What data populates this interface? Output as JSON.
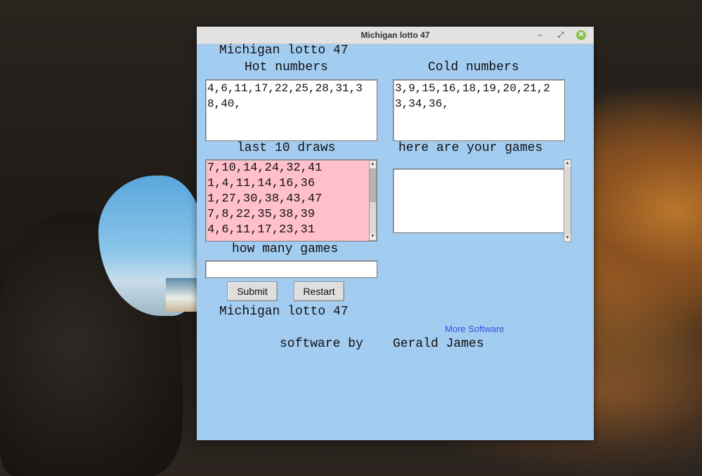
{
  "window": {
    "title": "Michigan lotto 47"
  },
  "header": {
    "title": "Michigan lotto 47"
  },
  "hot": {
    "label": "Hot numbers",
    "value": "4,6,11,17,22,25,28,31,38,40,"
  },
  "cold": {
    "label": "Cold numbers",
    "value": "3,9,15,16,18,19,20,21,23,34,36,"
  },
  "draws": {
    "label": "last 10 draws",
    "lines": [
      "7,10,14,24,32,41",
      "1,4,11,14,16,36",
      "1,27,30,38,43,47",
      "7,8,22,35,38,39",
      "4,6,11,17,23,31"
    ]
  },
  "games": {
    "label": "here are your games",
    "value": ""
  },
  "how_many": {
    "label": "how many games",
    "value": ""
  },
  "buttons": {
    "submit": "Submit",
    "restart": "Restart"
  },
  "footer": {
    "title": "Michigan lotto 47",
    "more_link": "More Software",
    "credit_prefix": "software by",
    "credit_name": "Gerald James"
  },
  "colors": {
    "window_bg": "#a3ccf1",
    "draws_bg": "#ffc0cb",
    "link": "#3c4fe0",
    "close_button": "#8bc34a"
  }
}
